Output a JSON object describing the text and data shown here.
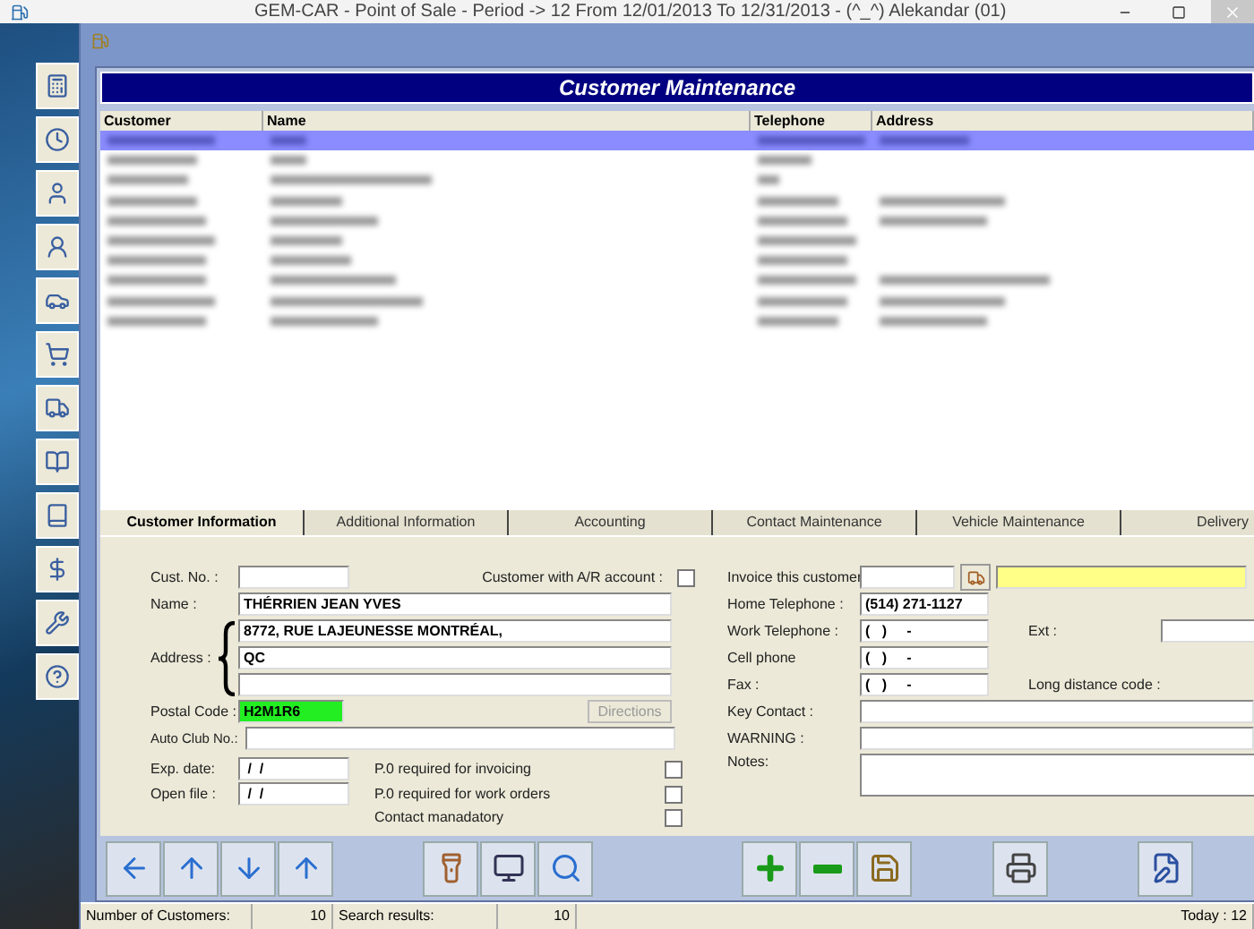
{
  "window": {
    "title": "GEM-CAR - Point of Sale - Period ->  12 From 12/01/2013 To 12/31/2013 - (^_^) Alekandar (01)"
  },
  "banner": {
    "title": "Customer Maintenance"
  },
  "table": {
    "columns": [
      "Customer",
      "Name",
      "Telephone",
      "Address"
    ],
    "rows": [
      {
        "selected": true
      },
      {
        "selected": false
      },
      {
        "selected": false
      },
      {
        "selected": false
      },
      {
        "selected": false
      },
      {
        "selected": false
      },
      {
        "selected": false
      },
      {
        "selected": false
      },
      {
        "selected": false
      },
      {
        "selected": false
      }
    ]
  },
  "tabs": [
    {
      "label": "Customer Information",
      "selected": true
    },
    {
      "label": "Additional Information",
      "selected": false
    },
    {
      "label": "Accounting",
      "selected": false
    },
    {
      "label": "Contact Maintenance",
      "selected": false
    },
    {
      "label": "Vehicle Maintenance",
      "selected": false
    },
    {
      "label": "Delivery",
      "selected": false
    }
  ],
  "form": {
    "cust_no": {
      "label": "Cust. No. :"
    },
    "ar_account": {
      "label": "Customer with A/R account :",
      "checked": false
    },
    "name": {
      "label": "Name :",
      "value": "THÉRRIEN JEAN YVES"
    },
    "address": {
      "label": "Address :",
      "lines": [
        "8772, RUE LAJEUNESSE MONTRÉAL,",
        "QC"
      ]
    },
    "postal_code": {
      "label": "Postal Code :",
      "value": "H2M1R6"
    },
    "directions": {
      "label": "Directions",
      "disabled": true
    },
    "auto_club": {
      "label": "Auto Club No.:"
    },
    "exp_date": {
      "label": "Exp. date:",
      "value": " /  /"
    },
    "open_file": {
      "label": "Open file :",
      "value": " /  /"
    },
    "options": [
      {
        "label": "P.0 required for invoicing",
        "checked": false
      },
      {
        "label": "P.0 required for work orders",
        "checked": false
      },
      {
        "label": "Contact manadatory",
        "checked": false
      }
    ],
    "invoice_customer": {
      "label": "Invoice this customer"
    },
    "home_tel": {
      "label": "Home Telephone :",
      "value": "(514) 271-1127"
    },
    "work_tel": {
      "label": "Work Telephone :",
      "value": "(   )     -"
    },
    "ext": {
      "label": "Ext :"
    },
    "cell": {
      "label": "Cell phone",
      "value": "(   )     -"
    },
    "fax": {
      "label": "Fax :",
      "value": "(   )     -"
    },
    "long_distance": {
      "label": "Long distance code :"
    },
    "key_contact": {
      "label": "Key Contact :"
    },
    "warning": {
      "label": "WARNING :"
    },
    "notes": {
      "label": "Notes:"
    }
  },
  "status_bar": {
    "customers_label": "Number of Customers:",
    "customers": "10",
    "results_label": "Search results:",
    "results": "10",
    "today": "Today : 12"
  }
}
